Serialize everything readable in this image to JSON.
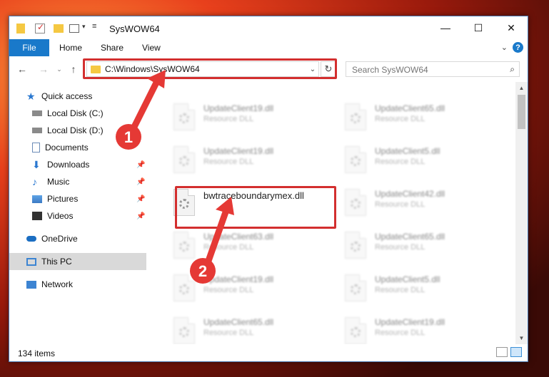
{
  "window": {
    "title": "SysWOW64",
    "minimize": "—",
    "maximize": "☐",
    "close": "✕"
  },
  "ribbon": {
    "file": "File",
    "tabs": [
      "Home",
      "Share",
      "View"
    ],
    "help": "?"
  },
  "address": {
    "path": "C:\\Windows\\SysWOW64"
  },
  "search": {
    "placeholder": "Search SysWOW64"
  },
  "sidebar": {
    "items": [
      {
        "label": "Quick access",
        "icon": "star-icon"
      },
      {
        "label": "Local Disk (C:)",
        "icon": "drive-c-icon"
      },
      {
        "label": "Local Disk (D:)",
        "icon": "drive-d-icon"
      },
      {
        "label": "Documents",
        "icon": "documents-icon"
      },
      {
        "label": "Downloads",
        "icon": "downloads-icon"
      },
      {
        "label": "Music",
        "icon": "music-icon"
      },
      {
        "label": "Pictures",
        "icon": "pictures-icon"
      },
      {
        "label": "Videos",
        "icon": "videos-icon"
      },
      {
        "label": "OneDrive",
        "icon": "cloud-icon"
      },
      {
        "label": "This PC",
        "icon": "computer-icon"
      },
      {
        "label": "Network",
        "icon": "network-icon"
      }
    ]
  },
  "files": {
    "left": [
      {
        "name": "UpdateClient19.dll",
        "type": "Resource DLL"
      },
      {
        "name": "UpdateClient19.dll",
        "type": "Resource DLL"
      },
      {
        "name": "bwtraceboundarymex.dll",
        "type": ""
      },
      {
        "name": "UpdateClient63.dll",
        "type": "Resource DLL"
      },
      {
        "name": "UpdateClient19.dll",
        "type": "Resource DLL"
      },
      {
        "name": "UpdateClient65.dll",
        "type": "Resource DLL"
      }
    ],
    "right": [
      {
        "name": "UpdateClient65.dll",
        "type": "Resource DLL"
      },
      {
        "name": "UpdateClient5.dll",
        "type": "Resource DLL"
      },
      {
        "name": "UpdateClient42.dll",
        "type": "Resource DLL"
      },
      {
        "name": "UpdateClient65.dll",
        "type": "Resource DLL"
      },
      {
        "name": "UpdateClient5.dll",
        "type": "Resource DLL"
      },
      {
        "name": "UpdateClient19.dll",
        "type": "Resource DLL"
      }
    ]
  },
  "status": {
    "count": "134 items"
  },
  "annotations": {
    "step1": "1",
    "step2": "2",
    "color": "#e53935"
  }
}
